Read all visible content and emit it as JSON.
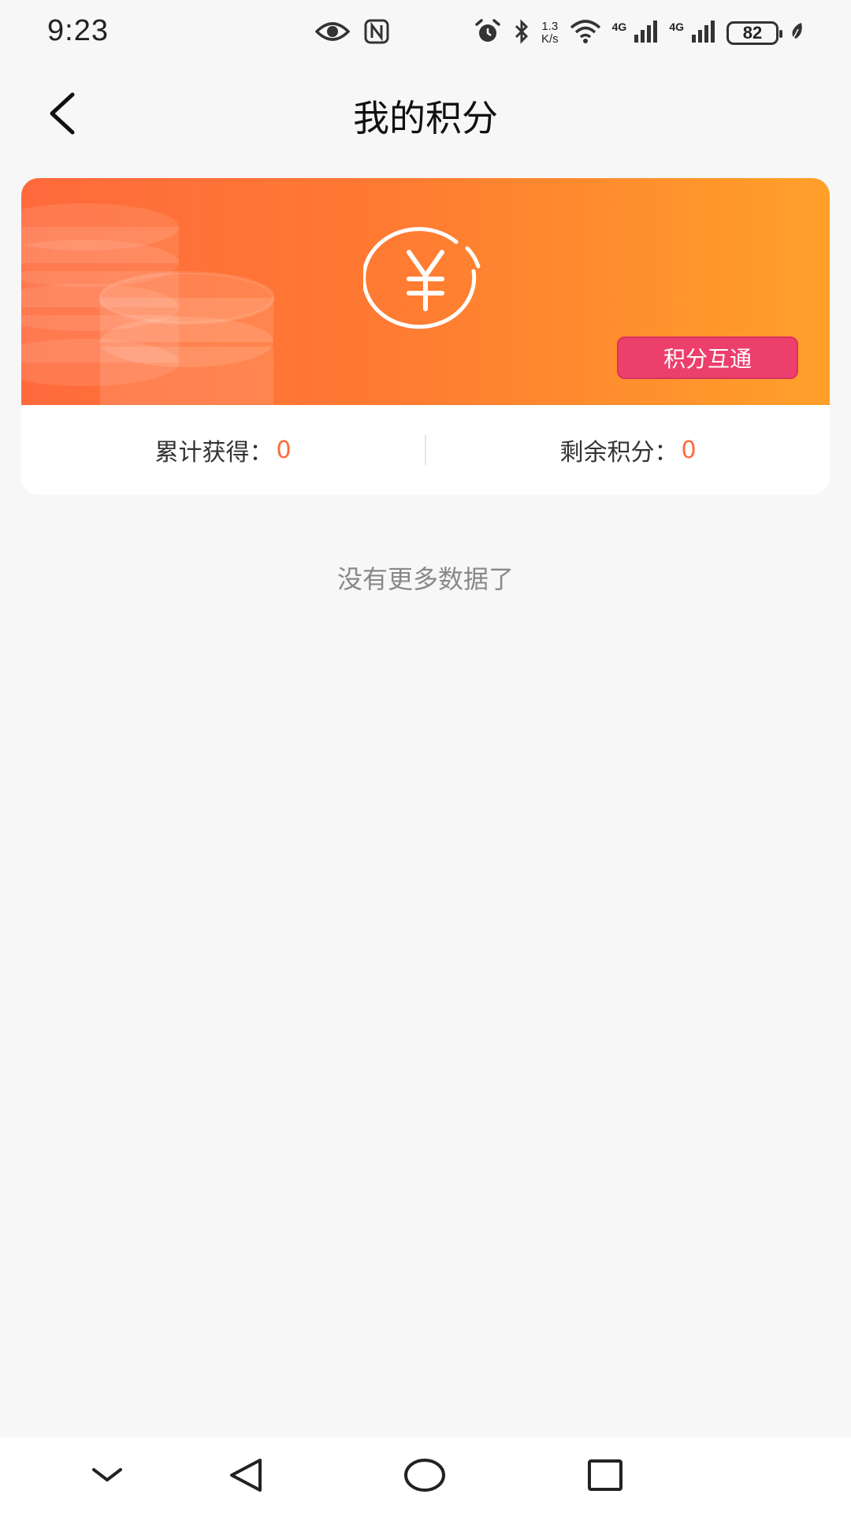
{
  "status_bar": {
    "time": "9:23",
    "net_speed_value": "1.3",
    "net_speed_unit": "K/s",
    "signal_1_label": "4G",
    "signal_2_label": "4G",
    "battery": "82"
  },
  "header": {
    "title": "我的积分"
  },
  "points_card": {
    "exchange_button_label": "积分互通",
    "total_earned_label": "累计获得：",
    "total_earned_value": "0",
    "remaining_label": "剩余积分：",
    "remaining_value": "0"
  },
  "list": {
    "empty_text": "没有更多数据了"
  },
  "colors": {
    "accent": "#ff6a3d",
    "banner_start": "#ff6a3d",
    "banner_end": "#ffa02a",
    "exchange_button": "#ec3f6b"
  },
  "nav": {
    "icons": [
      "chevron-down-icon",
      "back-triangle-icon",
      "home-circle-icon",
      "recents-square-icon"
    ]
  }
}
